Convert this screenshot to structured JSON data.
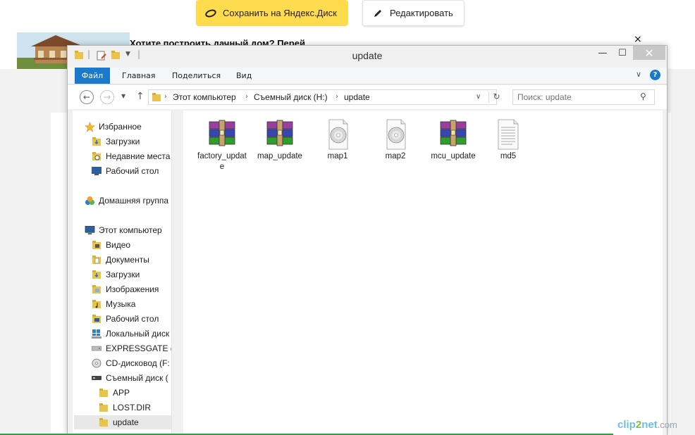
{
  "yandex_bar": {
    "save_label": "Сохранить на Яндекс.Диск",
    "edit_label": "Редактировать"
  },
  "background_page": {
    "ad_title": "Хотите построить дачный дом? Перей",
    "close_glyph": "×",
    "watermark": {
      "part1": "clip",
      "part2": "2",
      "part3": "net",
      "part4": ".com"
    }
  },
  "window": {
    "title": "update",
    "controls": {
      "minimize": "—",
      "maximize": "☐",
      "close": "✕"
    }
  },
  "ribbon": {
    "tabs": [
      "Файл",
      "Главная",
      "Поделиться",
      "Вид"
    ],
    "help": "?"
  },
  "address_bar": {
    "crumbs": [
      "Этот компьютер",
      "Съемный диск (H:)",
      "update"
    ],
    "search_placeholder": "Поиск: update"
  },
  "nav_pane": {
    "favorites": {
      "header": "Избранное",
      "items": [
        "Загрузки",
        "Недавние места",
        "Рабочий стол"
      ]
    },
    "homegroup": "Домашняя группа",
    "this_pc": {
      "header": "Этот компьютер",
      "items": [
        "Видео",
        "Документы",
        "Загрузки",
        "Изображения",
        "Музыка",
        "Рабочий стол",
        "Локальный диск",
        "EXPRESSGATE (D",
        "CD-дисковод (F:",
        "Съемный диск ("
      ]
    },
    "removable_children": [
      "APP",
      "LOST.DIR",
      "update"
    ],
    "selected": "update"
  },
  "files": [
    {
      "name": "factory_update",
      "icon": "rar-archive-icon"
    },
    {
      "name": "map_update",
      "icon": "rar-archive-icon"
    },
    {
      "name": "map1",
      "icon": "disc-image-icon"
    },
    {
      "name": "map2",
      "icon": "disc-image-icon"
    },
    {
      "name": "mcu_update",
      "icon": "rar-archive-icon"
    },
    {
      "name": "md5",
      "icon": "text-file-icon"
    }
  ],
  "colors": {
    "yandex_yellow": "#ffdb4d",
    "file_tab_blue": "#1979ca",
    "folder_yellow": "#e8c44a"
  }
}
